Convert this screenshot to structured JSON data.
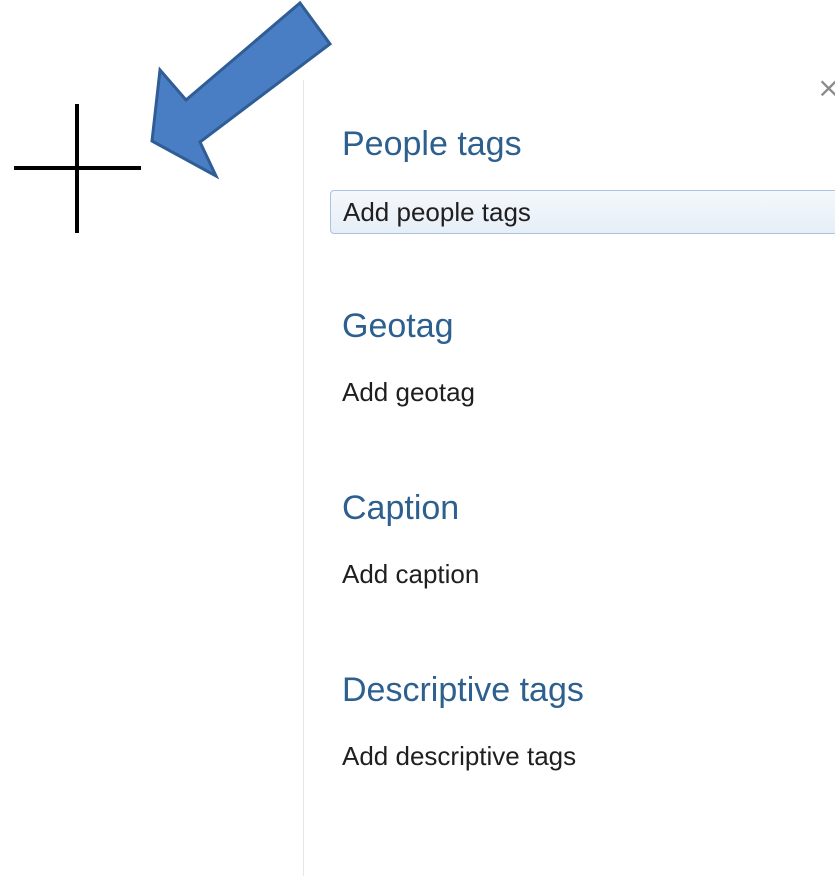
{
  "panel": {
    "close_glyph": "×",
    "sections": [
      {
        "heading": "People tags",
        "action": "Add people tags"
      },
      {
        "heading": "Geotag",
        "action": "Add geotag"
      },
      {
        "heading": "Caption",
        "action": "Add caption"
      },
      {
        "heading": "Descriptive tags",
        "action": "Add descriptive tags"
      }
    ]
  },
  "annotation": {
    "arrow_color": "#4a7ec4",
    "arrow_border_color": "#2f5d95",
    "crosshair_color": "#000000",
    "icons": [
      "crosshair-icon",
      "pointer-arrow-icon"
    ]
  }
}
